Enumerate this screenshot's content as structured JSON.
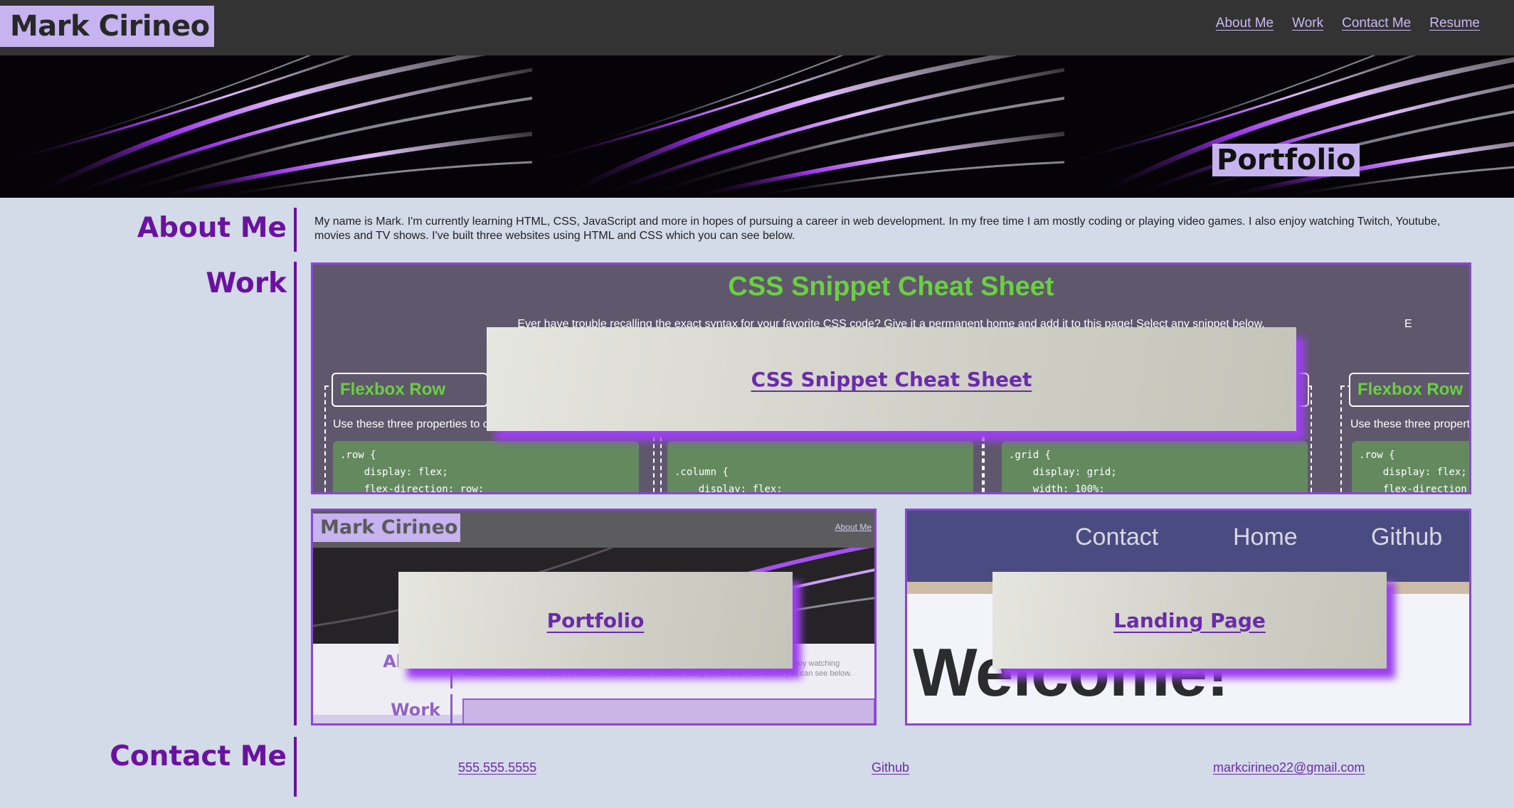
{
  "header": {
    "brand": "Mark Cirineo",
    "nav": [
      "About Me",
      "Work",
      "Contact Me",
      "Resume"
    ]
  },
  "hero": {
    "title": "Portfolio"
  },
  "about": {
    "heading": "About Me",
    "text": "My name is Mark. I'm currently learning HTML, CSS, JavaScript and more in hopes of pursuing a career in web development. In my free time I am mostly coding or playing video games. I also enjoy watching Twitch, Youtube, movies and TV shows. I've built three websites using HTML and CSS which you can see below."
  },
  "work": {
    "heading": "Work",
    "projects": [
      {
        "label": "CSS Snippet Cheat Sheet",
        "preview": {
          "title": "CSS Snippet Cheat Sheet",
          "subtitle": "Ever have trouble recalling the exact syntax for your favorite CSS code? Give it a permanent home and add it to this page! Select any snippet below.",
          "cut_text": "E",
          "card1_title": "Flexbox Row",
          "card1_desc": "Use these three properties to c",
          "card1_code": ".row {\n    display: flex;\n    flex-direction: row;",
          "card2_code": "\n.column {\n    display: flex;",
          "card3_code": ".grid {\n    display: grid;\n    width: 100%;",
          "card4_title": "Flexbox Row",
          "card4_desc": "Use these three propert",
          "card4_code": ".row {\n    display: flex;\n    flex-direction"
        }
      },
      {
        "label": "Portfolio",
        "preview": {
          "brand": "Mark Cirineo",
          "nav": "About Me",
          "section1": "About",
          "section2": "Work",
          "text": "career in web development. In my free time I am mostly coding or playing video games. I also enjoy watching Twitch, Youtube, movies and TV shows. I've built three websites using HTML and CSS which you can see below."
        }
      },
      {
        "label": "Landing Page",
        "preview": {
          "nav": [
            "Contact",
            "Home",
            "Github"
          ],
          "headline": "Welcome!"
        }
      }
    ]
  },
  "contact": {
    "heading": "Contact Me",
    "phone": "555.555.5555",
    "github": "Github",
    "email": "markcirineo22@gmail.com"
  },
  "colors": {
    "accent": "#6a12a0",
    "brand_bg": "#c6b3f0",
    "header_bg": "#333333",
    "page_bg": "#d3dae8",
    "card_border": "#8a45d6"
  }
}
